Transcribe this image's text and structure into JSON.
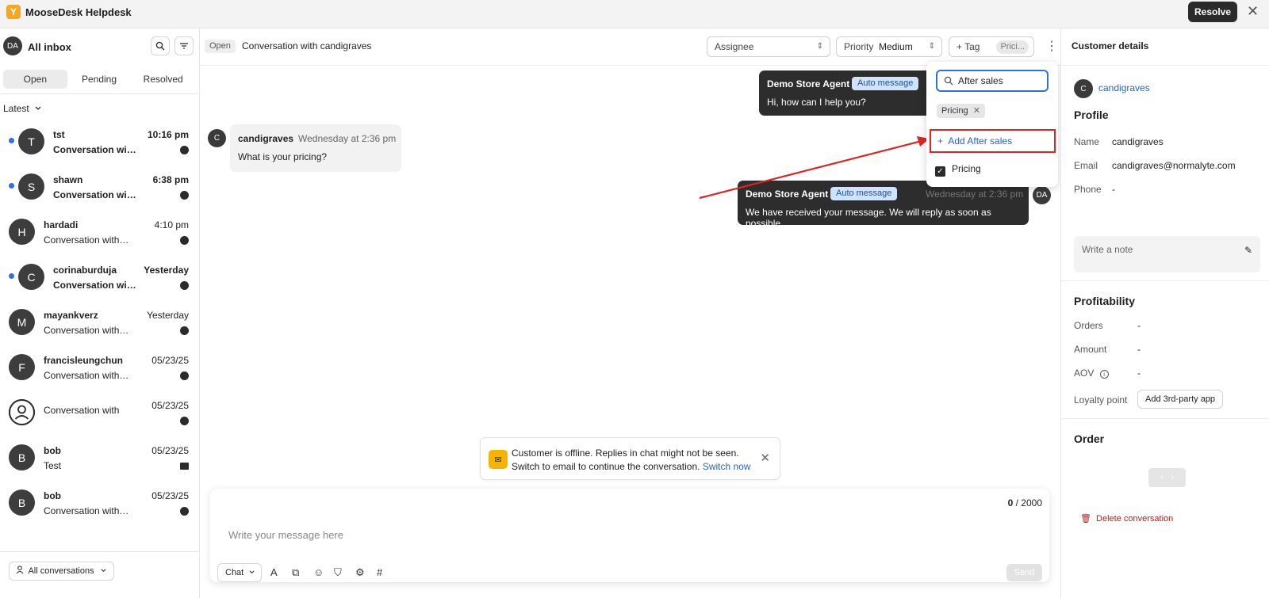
{
  "app": {
    "title": "MooseDesk Helpdesk",
    "logo_glyph": "Y",
    "resolve_label": "Resolve",
    "close_glyph": "✕"
  },
  "sidebar": {
    "avatar": "DA",
    "title": "All inbox",
    "tabs": [
      {
        "label": "Open"
      },
      {
        "label": "Pending"
      },
      {
        "label": "Resolved"
      }
    ],
    "sort_label": "Latest",
    "conversations": [
      {
        "avatar": "T",
        "name": "tst",
        "time": "10:16 pm",
        "preview": "Conversation with candigraves",
        "unread": true,
        "channel": "chat"
      },
      {
        "avatar": "S",
        "name": "shawn",
        "time": "6:38 pm",
        "preview": "Conversation with candigraves",
        "unread": true,
        "channel": "chat"
      },
      {
        "avatar": "H",
        "name": "hardadi",
        "time": "4:10 pm",
        "preview": "Conversation with candigraves",
        "unread": false,
        "channel": "chat"
      },
      {
        "avatar": "C",
        "name": "corinaburduja",
        "time": "Yesterday",
        "preview": "Conversation with candigraves",
        "unread": true,
        "channel": "chat"
      },
      {
        "avatar": "M",
        "name": "mayankverz",
        "time": "Yesterday",
        "preview": "Conversation with candigraves",
        "unread": false,
        "channel": "chat"
      },
      {
        "avatar": "F",
        "name": "francisleungchun",
        "time": "05/23/25",
        "preview": "Conversation with candigraves",
        "unread": false,
        "channel": "chat"
      },
      {
        "avatar": "person",
        "name": "",
        "time": "05/23/25",
        "preview": "Conversation with",
        "unread": false,
        "channel": "chat"
      },
      {
        "avatar": "B",
        "name": "bob",
        "time": "05/23/25",
        "preview": "Test",
        "unread": false,
        "channel": "mail"
      },
      {
        "avatar": "B",
        "name": "bob",
        "time": "05/23/25",
        "preview": "Conversation with candigraves",
        "unread": false,
        "channel": "chat"
      }
    ],
    "footer_label": "All conversations"
  },
  "main": {
    "status": "Open",
    "title": "Conversation with candigraves",
    "assignee_label": "Assignee",
    "priority_label": "Priority",
    "priority_value": "Medium",
    "tag_label": "+ Tag",
    "tag_chip": "Prici...",
    "messages": {
      "agent1": {
        "sender": "Demo Store Agent",
        "badge": "Auto message",
        "body": "Hi, how can I help you?"
      },
      "customer": {
        "avatar": "C",
        "sender": "candigraves",
        "time": "Wednesday at 2:36 pm",
        "body": "What is your pricing?"
      },
      "agent2": {
        "avatar": "DA",
        "sender": "Demo Store Agent",
        "badge": "Auto message",
        "time": "Wednesday at 2:36 pm",
        "body": "We have received your message. We will reply as soon as possible"
      }
    },
    "offline": {
      "line1": "Customer is offline. Replies in chat might not be seen.",
      "line2": "Switch to email to continue the conversation.",
      "link": "Switch now"
    },
    "composer": {
      "count": "0",
      "max": "/ 2000",
      "placeholder": "Write your message here",
      "channel": "Chat",
      "send": "Send"
    }
  },
  "tag_dropdown": {
    "search_value": "After sales",
    "selected_chip": "Pricing",
    "add_option": "Add After sales",
    "option": "Pricing",
    "option_checked": true,
    "highlight_color": "#e02424"
  },
  "customer_panel": {
    "title": "Customer details",
    "avatar": "C",
    "username": "candigraves",
    "profile_heading": "Profile",
    "name_label": "Name",
    "name_value": "candigraves",
    "email_label": "Email",
    "email_value": "candigraves@normalyte.com",
    "phone_label": "Phone",
    "phone_value": "-",
    "note_placeholder": "Write a note",
    "profitability_heading": "Profitability",
    "orders_label": "Orders",
    "orders_value": "-",
    "amount_label": "Amount",
    "amount_value": "-",
    "aov_label": "AOV",
    "aov_value": "-",
    "loyalty_label": "Loyalty point",
    "loyalty_button": "Add 3rd-party app",
    "order_heading": "Order",
    "delete_label": "Delete conversation"
  }
}
